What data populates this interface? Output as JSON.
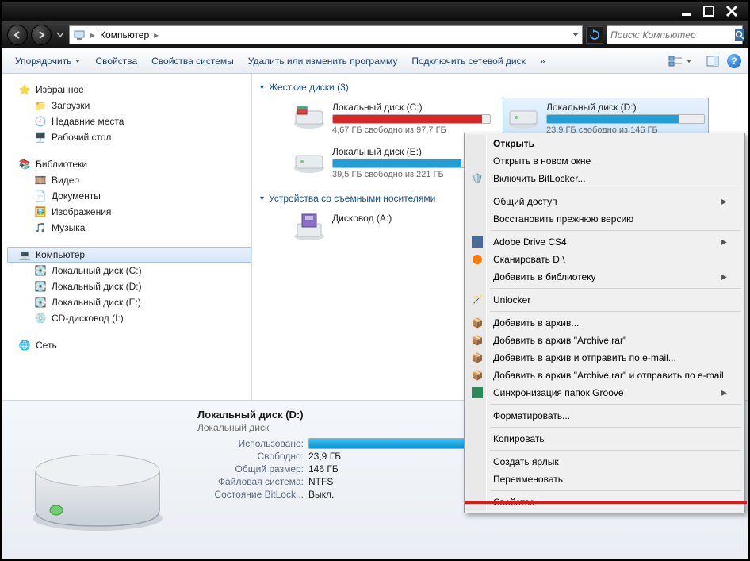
{
  "breadcrumb": {
    "location": "Компьютер"
  },
  "search": {
    "placeholder": "Поиск: Компьютер"
  },
  "toolbar": {
    "organize": "Упорядочить",
    "properties": "Свойства",
    "sys_properties": "Свойства системы",
    "uninstall": "Удалить или изменить программу",
    "map_drive": "Подключить сетевой диск",
    "more": "»"
  },
  "sidebar": {
    "favorites": {
      "label": "Избранное",
      "items": [
        "Загрузки",
        "Недавние места",
        "Рабочий стол"
      ]
    },
    "libraries": {
      "label": "Библиотеки",
      "items": [
        "Видео",
        "Документы",
        "Изображения",
        "Музыка"
      ]
    },
    "computer": {
      "label": "Компьютер",
      "items": [
        "Локальный диск (C:)",
        "Локальный диск (D:)",
        "Локальный диск (E:)",
        "CD-дисковод (I:)"
      ]
    },
    "network": {
      "label": "Сеть"
    }
  },
  "main": {
    "cat_hdd": "Жесткие диски (3)",
    "cat_removable": "Устройства со съемными носителями",
    "drives": {
      "c": {
        "name": "Локальный диск (C:)",
        "free": "4,67 ГБ свободно из 97,7 ГБ",
        "fill": 95,
        "color": "#d72626"
      },
      "d": {
        "name": "Локальный диск (D:)",
        "free": "23,9 ГБ свободно из 146 ГБ",
        "fill": 84,
        "color": "#1f9fd6"
      },
      "e": {
        "name": "Локальный диск (E:)",
        "free": "39,5 ГБ свободно из 221 ГБ",
        "fill": 82,
        "color": "#1f9fd6"
      },
      "a": {
        "name": "Дисковод (A:)"
      }
    }
  },
  "details": {
    "title": "Локальный диск (D:)",
    "subtitle": "Локальный диск",
    "used_label": "Использовано:",
    "free_label": "Свободно:",
    "free_val": "23,9 ГБ",
    "total_label": "Общий размер:",
    "total_val": "146 ГБ",
    "fs_label": "Файловая система:",
    "fs_val": "NTFS",
    "bitlocker_label": "Состояние BitLock...",
    "bitlocker_val": "Выкл.",
    "used_pct": 84
  },
  "context_menu": {
    "open": "Открыть",
    "open_new": "Открыть в новом окне",
    "bitlocker": "Включить BitLocker...",
    "share": "Общий доступ",
    "restore": "Восстановить прежнюю версию",
    "adobe": "Adobe Drive CS4",
    "scan": "Сканировать D:\\",
    "add_lib": "Добавить в библиотеку",
    "unlocker": "Unlocker",
    "add_arch": "Добавить в архив...",
    "add_arch_rar": "Добавить в архив \"Archive.rar\"",
    "add_arch_mail": "Добавить в архив и отправить по e-mail...",
    "add_arch_rar_mail": "Добавить в архив \"Archive.rar\" и отправить по e-mail",
    "groove": "Синхронизация папок Groove",
    "format": "Форматировать...",
    "copy": "Копировать",
    "shortcut": "Создать ярлык",
    "rename": "Переименовать",
    "properties": "Свойства"
  }
}
